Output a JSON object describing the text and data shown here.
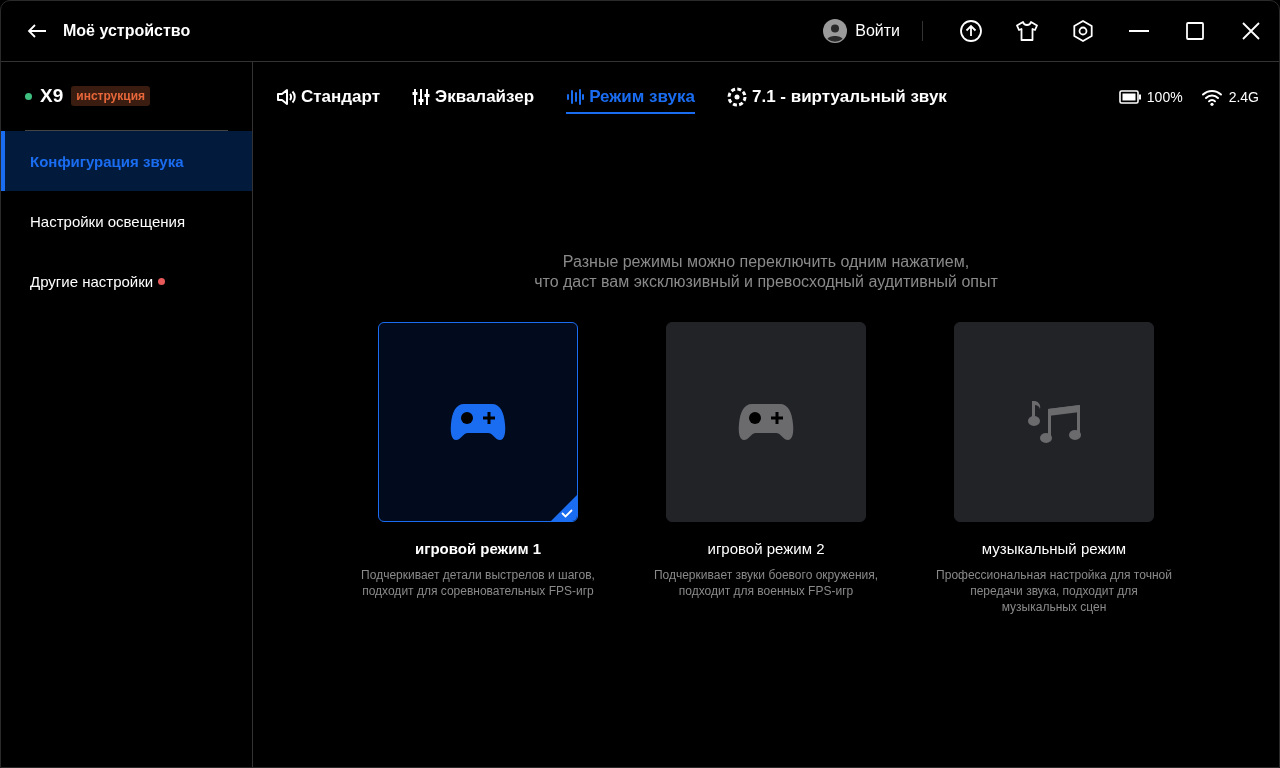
{
  "window": {
    "title": "Моё устройство",
    "login": "Войти"
  },
  "device": {
    "name": "X9",
    "manual": "инструкция"
  },
  "sidebar": {
    "items": [
      {
        "label": "Конфигурация звука",
        "selected": true,
        "notice": false
      },
      {
        "label": "Настройки освещения",
        "selected": false,
        "notice": false
      },
      {
        "label": "Другие настройки",
        "selected": false,
        "notice": true
      }
    ]
  },
  "tabs": [
    {
      "label": "Стандарт",
      "kind": "speaker",
      "selected": false
    },
    {
      "label": "Эквалайзер",
      "kind": "sliders",
      "selected": false
    },
    {
      "label": "Режим звука",
      "kind": "wave",
      "selected": true
    },
    {
      "label": "7.1 - виртуальный звук",
      "kind": "surround",
      "selected": false
    }
  ],
  "status": {
    "battery": "100%",
    "wireless": "2.4G"
  },
  "intro": [
    "Разные режимы можно переключить одним нажатием,",
    "что даст вам эксклюзивный и превосходный аудитивный опыт"
  ],
  "modes": [
    {
      "title": "игровой режим 1",
      "kind": "gamepad",
      "selected": true,
      "description": "Подчеркивает детали выстрелов и шагов, подходит для соревновательных FPS-игр"
    },
    {
      "title": "игровой режим 2",
      "kind": "gamepad",
      "selected": false,
      "description": "Подчеркивает звуки боевого окружения, подходит для военных FPS-игр"
    },
    {
      "title": "музыкальный режим",
      "kind": "music",
      "selected": false,
      "description": "Профессиональная настройка для точной передачи звука, подходит для музыкальных сцен"
    }
  ]
}
